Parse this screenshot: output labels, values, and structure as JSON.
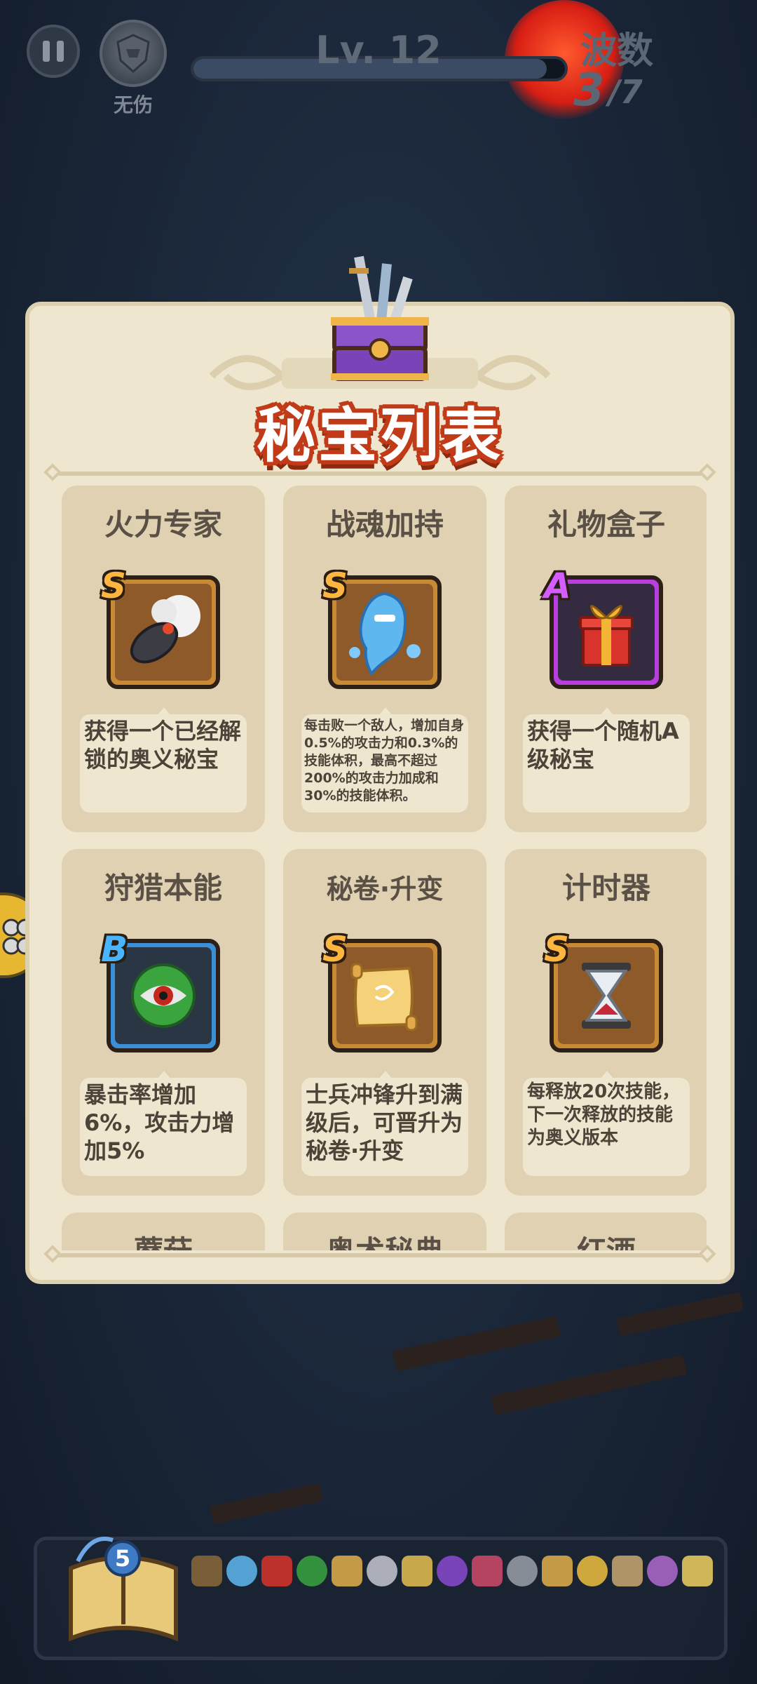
{
  "hud": {
    "pause_icon": "pause-icon",
    "no_damage_label": "无伤",
    "level": "Lv. 12",
    "xp_progress": 0.95,
    "wave_label": "波数",
    "wave_current": "3",
    "wave_total": "/7"
  },
  "modal": {
    "title": "秘宝列表",
    "header_icon": "treasure-chest-icon",
    "items": [
      {
        "name": "火力专家",
        "grade": "S",
        "icon": "cannon-icon",
        "desc": "获得一个已经解锁的奥义秘宝"
      },
      {
        "name": "战魂加持",
        "grade": "S",
        "icon": "spirit-icon",
        "desc": "每击败一个敌人，增加自身0.5%的攻击力和0.3%的技能体积，最高不超过200%的攻击力加成和30%的技能体积。"
      },
      {
        "name": "礼物盒子",
        "grade": "A",
        "icon": "gift-box-icon",
        "desc": "获得一个随机A级秘宝"
      },
      {
        "name": "狩猎本能",
        "grade": "B",
        "icon": "hunter-eye-icon",
        "desc": "暴击率增加6%，攻击力增加5%"
      },
      {
        "name": "秘卷·升变",
        "grade": "S",
        "icon": "scroll-icon",
        "desc": "士兵冲锋升到满级后，可晋升为秘卷·升变"
      },
      {
        "name": "计时器",
        "grade": "S",
        "icon": "hourglass-icon",
        "desc": "每释放20次技能，下一次释放的技能为奥义版本"
      },
      {
        "name": "蘑菇",
        "grade": "",
        "icon": "",
        "desc": ""
      },
      {
        "name": "奥术秘典",
        "grade": "",
        "icon": "",
        "desc": ""
      },
      {
        "name": "红酒",
        "grade": "",
        "icon": "",
        "desc": ""
      }
    ]
  },
  "bottom": {
    "spellbook_count": "5",
    "inventory_icons": [
      "cannon-icon",
      "spirit-icon",
      "gift-box-icon",
      "hunter-eye-icon",
      "scroll-icon",
      "hourglass-icon",
      "flame-icon",
      "card-icon",
      "potion-icon",
      "skull-icon",
      "scroll-icon",
      "coin-icon",
      "bone-icon",
      "rune-icon",
      "bolt-icon"
    ]
  },
  "colors": {
    "modal_bg": "#efe6cf",
    "card_bg": "#dfd1b2",
    "title_stroke": "#c23b18",
    "grade_S": "#ffb640",
    "grade_A": "#d55cff",
    "grade_B": "#4ab4ff"
  }
}
